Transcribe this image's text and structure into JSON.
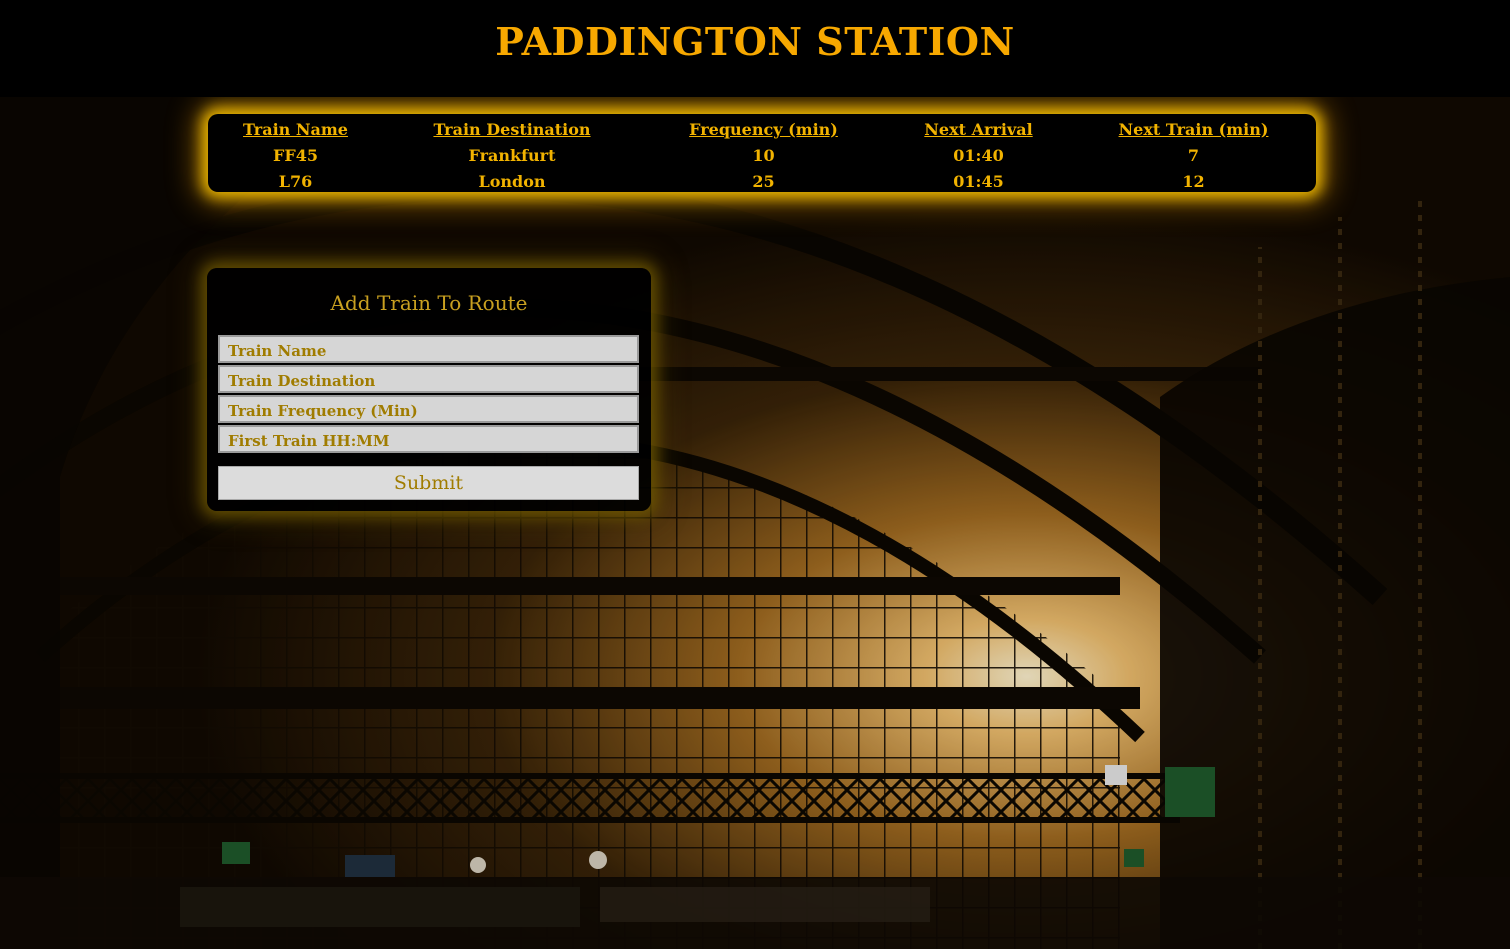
{
  "header": {
    "title": "PADDINGTON STATION"
  },
  "schedule": {
    "columns": [
      "Train Name",
      "Train Destination",
      "Frequency (min)",
      "Next Arrival",
      "Next Train (min)"
    ],
    "rows": [
      [
        "FF45",
        "Frankfurt",
        "10",
        "01:40",
        "7"
      ],
      [
        "L76",
        "London",
        "25",
        "01:45",
        "12"
      ]
    ]
  },
  "form": {
    "title": "Add Train To Route",
    "fields": {
      "train_name": {
        "value": "",
        "placeholder": "Train Name"
      },
      "train_destination": {
        "value": "",
        "placeholder": "Train Destination"
      },
      "train_frequency": {
        "value": "",
        "placeholder": "Train Frequency (Min)"
      },
      "first_train": {
        "value": "",
        "placeholder": "First Train HH:MM"
      }
    },
    "submit_label": "Submit"
  },
  "colors": {
    "accent": "#f7a800",
    "table_text": "#f2b300",
    "glow": "#ffc800",
    "form_text": "#a07c00",
    "background": "#000000"
  }
}
